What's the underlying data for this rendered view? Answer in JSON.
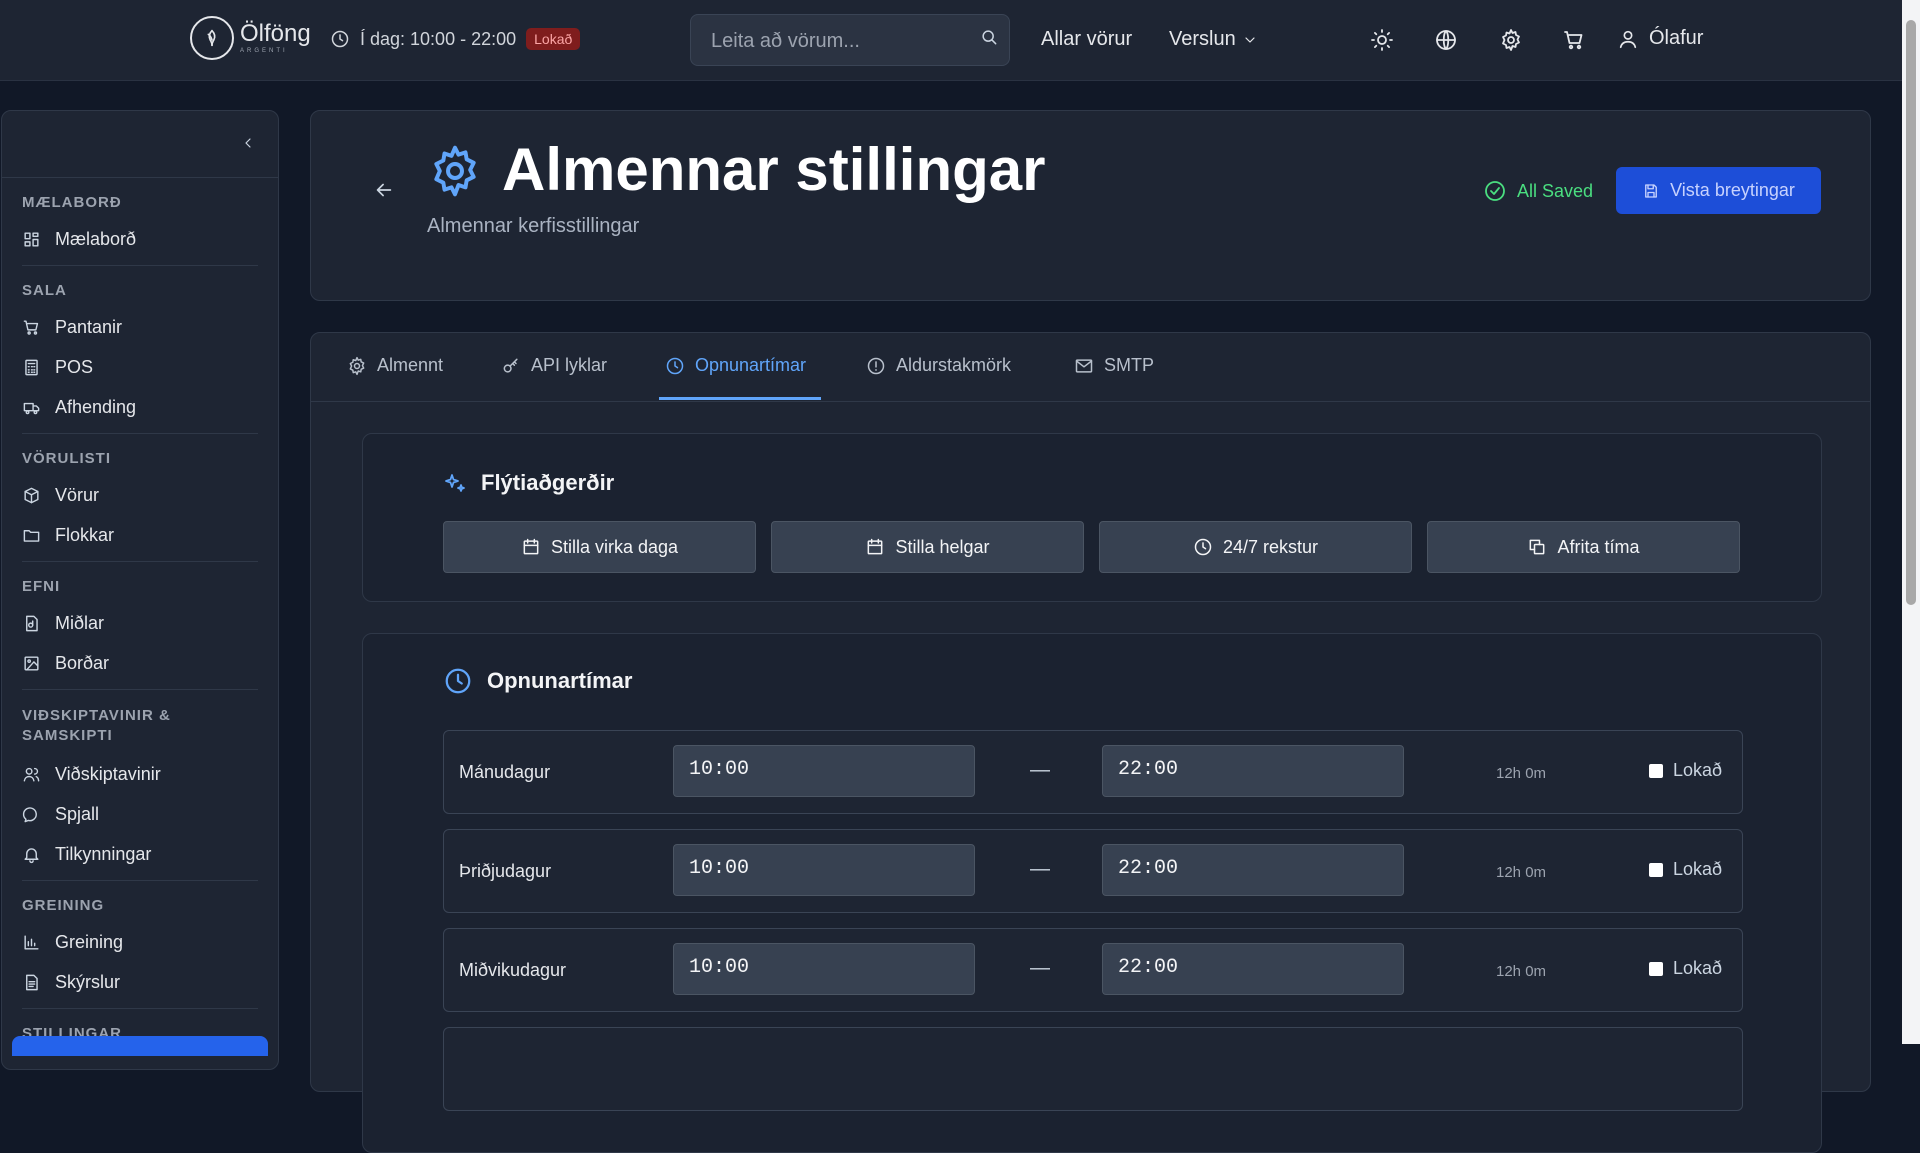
{
  "header": {
    "brand": "Ölföng",
    "brand_sub": "ARGENTI",
    "hours_text": "Í dag: 10:00 - 22:00",
    "status_badge": "Lokað",
    "search_placeholder": "Leita að vörum...",
    "nav": {
      "all_products": "Allar vörur",
      "store": "Verslun"
    },
    "user_name": "Ólafur"
  },
  "sidebar": {
    "sections": [
      {
        "heading": "MÆLABORÐ",
        "items": [
          {
            "label": "Mælaborð",
            "icon": "dashboard-icon"
          }
        ]
      },
      {
        "heading": "SALA",
        "items": [
          {
            "label": "Pantanir",
            "icon": "cart-icon"
          },
          {
            "label": "POS",
            "icon": "calculator-icon"
          },
          {
            "label": "Afhending",
            "icon": "truck-icon"
          }
        ]
      },
      {
        "heading": "VÖRULISTI",
        "items": [
          {
            "label": "Vörur",
            "icon": "package-icon"
          },
          {
            "label": "Flokkar",
            "icon": "folder-icon"
          }
        ]
      },
      {
        "heading": "EFNI",
        "items": [
          {
            "label": "Miðlar",
            "icon": "media-file-icon"
          },
          {
            "label": "Borðar",
            "icon": "image-icon"
          }
        ]
      },
      {
        "heading": "VIÐSKIPTAVINIR & SAMSKIPTI",
        "items": [
          {
            "label": "Viðskiptavinir",
            "icon": "users-icon"
          },
          {
            "label": "Spjall",
            "icon": "chat-icon"
          },
          {
            "label": "Tilkynningar",
            "icon": "bell-icon"
          }
        ]
      },
      {
        "heading": "GREINING",
        "items": [
          {
            "label": "Greining",
            "icon": "bar-chart-icon"
          },
          {
            "label": "Skýrslur",
            "icon": "report-icon"
          }
        ]
      },
      {
        "heading": "STILLINGAR",
        "items": []
      }
    ]
  },
  "page": {
    "title": "Almennar stillingar",
    "subtitle": "Almennar kerfisstillingar",
    "saved_status": "All Saved",
    "save_button": "Vista breytingar"
  },
  "tabs": [
    {
      "label": "Almennt",
      "icon": "gear-icon"
    },
    {
      "label": "API lyklar",
      "icon": "key-icon"
    },
    {
      "label": "Opnunartímar",
      "icon": "clock-icon",
      "active": true
    },
    {
      "label": "Aldurstakmörk",
      "icon": "alert-circle-icon"
    },
    {
      "label": "SMTP",
      "icon": "mail-icon"
    }
  ],
  "quick_actions": {
    "title": "Flýtiaðgerðir",
    "buttons": [
      {
        "label": "Stilla virka daga",
        "icon": "calendar-icon"
      },
      {
        "label": "Stilla helgar",
        "icon": "calendar-icon"
      },
      {
        "label": "24/7 rekstur",
        "icon": "clock-icon"
      },
      {
        "label": "Afrita tíma",
        "icon": "copy-icon"
      }
    ]
  },
  "opening_hours": {
    "title": "Opnunartímar",
    "closed_label": "Lokað",
    "days": [
      {
        "name": "Mánudagur",
        "open": "10:00",
        "close": "22:00",
        "duration": "12h 0m",
        "closed": false
      },
      {
        "name": "Þriðjudagur",
        "open": "10:00",
        "close": "22:00",
        "duration": "12h 0m",
        "closed": false
      },
      {
        "name": "Miðvikudagur",
        "open": "10:00",
        "close": "22:00",
        "duration": "12h 0m",
        "closed": false
      }
    ]
  },
  "colors": {
    "accent": "#60a5fa",
    "save_button": "#1d4ed8",
    "saved_green": "#4ade80",
    "closed_badge": "#7f1d1d"
  }
}
